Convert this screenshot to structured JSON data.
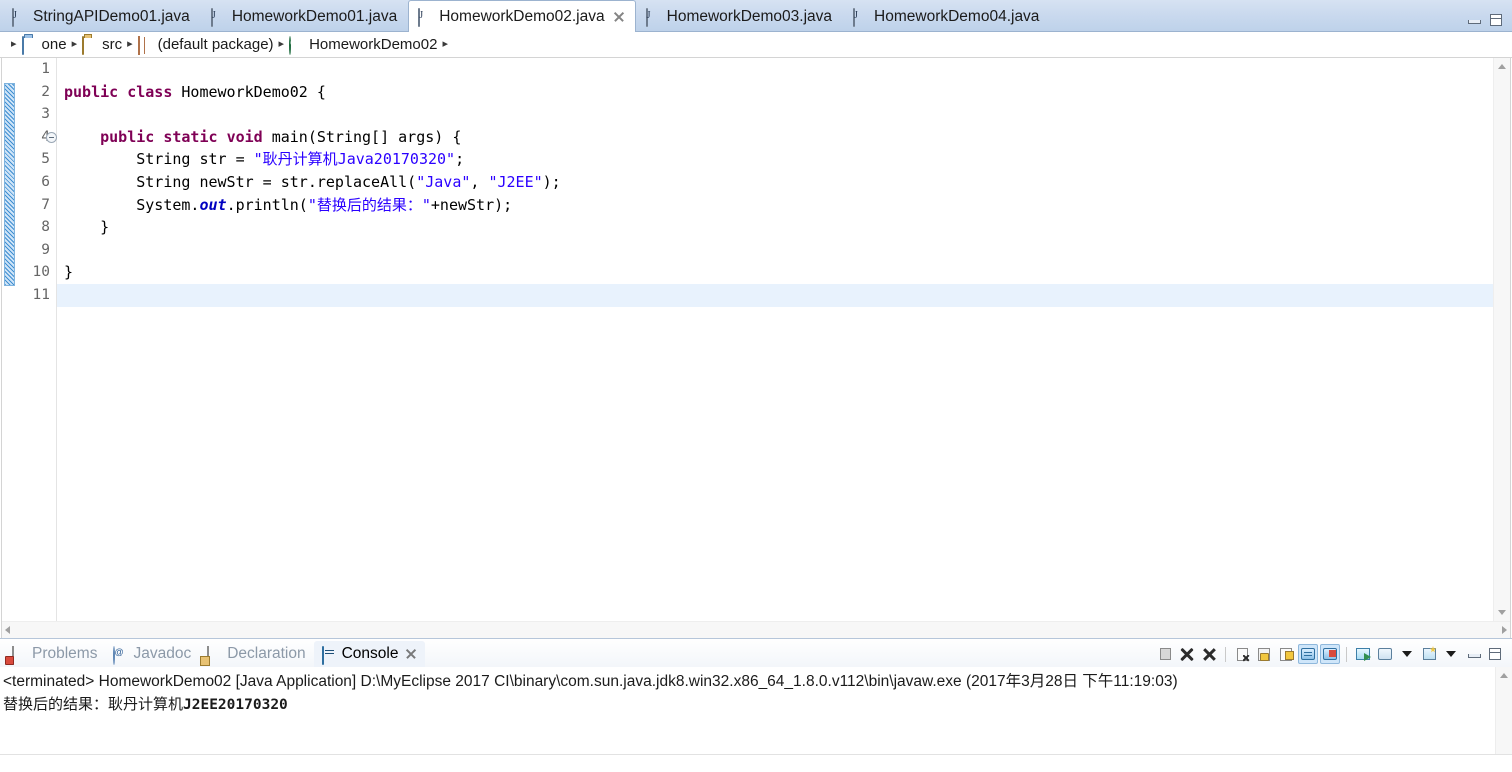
{
  "editor_tabs": [
    {
      "label": "StringAPIDemo01.java",
      "icon": "java-file-icon",
      "active": false,
      "closable": false
    },
    {
      "label": "HomeworkDemo01.java",
      "icon": "java-file-icon",
      "active": false,
      "closable": false
    },
    {
      "label": "HomeworkDemo02.java",
      "icon": "java-file-icon",
      "active": true,
      "closable": true
    },
    {
      "label": "HomeworkDemo03.java",
      "icon": "java-file-icon",
      "active": false,
      "closable": false
    },
    {
      "label": "HomeworkDemo04.java",
      "icon": "java-file-icon",
      "active": false,
      "closable": false
    }
  ],
  "window_controls": {
    "minimize": "minimize-icon",
    "maximize": "maximize-icon"
  },
  "breadcrumb": {
    "separator": "▸",
    "items": [
      {
        "label": "one",
        "icon": "project-icon"
      },
      {
        "label": "src",
        "icon": "source-folder-icon"
      },
      {
        "label": "(default package)",
        "icon": "package-icon"
      },
      {
        "label": "HomeworkDemo02",
        "icon": "class-icon"
      }
    ]
  },
  "editor": {
    "line_numbers": [
      "1",
      "2",
      "3",
      "4",
      "5",
      "6",
      "7",
      "8",
      "9",
      "10",
      "11"
    ],
    "fold_marker_line": 4,
    "current_line": 11,
    "marker_bar": {
      "from_line": 2,
      "to_line": 10
    },
    "colors": {
      "keyword": "#7f0055",
      "string": "#2a00ff",
      "static_field": "#0000c0",
      "plain": "#000000",
      "current_line_bg": "#e8f2fd",
      "line_number": "#666666"
    },
    "lines": [
      {
        "n": 1,
        "tokens": []
      },
      {
        "n": 2,
        "tokens": [
          {
            "t": "public",
            "c": "kw"
          },
          {
            "t": " ",
            "c": "plain"
          },
          {
            "t": "class",
            "c": "kw"
          },
          {
            "t": " HomeworkDemo02 {",
            "c": "plain"
          }
        ]
      },
      {
        "n": 3,
        "tokens": []
      },
      {
        "n": 4,
        "tokens": [
          {
            "t": "    ",
            "c": "plain"
          },
          {
            "t": "public",
            "c": "kw"
          },
          {
            "t": " ",
            "c": "plain"
          },
          {
            "t": "static",
            "c": "kw"
          },
          {
            "t": " ",
            "c": "plain"
          },
          {
            "t": "void",
            "c": "kw"
          },
          {
            "t": " main(String[] args) {",
            "c": "plain"
          }
        ]
      },
      {
        "n": 5,
        "tokens": [
          {
            "t": "        String str = ",
            "c": "plain"
          },
          {
            "t": "\"耿丹计算机Java20170320\"",
            "c": "str"
          },
          {
            "t": ";",
            "c": "plain"
          }
        ]
      },
      {
        "n": 6,
        "tokens": [
          {
            "t": "        String newStr = str.replaceAll(",
            "c": "plain"
          },
          {
            "t": "\"Java\"",
            "c": "str"
          },
          {
            "t": ", ",
            "c": "plain"
          },
          {
            "t": "\"J2EE\"",
            "c": "str"
          },
          {
            "t": ");",
            "c": "plain"
          }
        ]
      },
      {
        "n": 7,
        "tokens": [
          {
            "t": "        System.",
            "c": "plain"
          },
          {
            "t": "out",
            "c": "fld"
          },
          {
            "t": ".println(",
            "c": "plain"
          },
          {
            "t": "\"替换后的结果：\"",
            "c": "str"
          },
          {
            "t": "+newStr);",
            "c": "plain"
          }
        ]
      },
      {
        "n": 8,
        "tokens": [
          {
            "t": "    }",
            "c": "plain"
          }
        ]
      },
      {
        "n": 9,
        "tokens": []
      },
      {
        "n": 10,
        "tokens": [
          {
            "t": "}",
            "c": "plain"
          }
        ]
      },
      {
        "n": 11,
        "tokens": []
      }
    ],
    "scrollbar": {
      "vertical_up": "chevron-up-icon",
      "vertical_down": "chevron-down-icon",
      "horizontal_left": "chevron-left-icon",
      "horizontal_right": "chevron-right-icon"
    }
  },
  "bottom_panel": {
    "view_tabs": [
      {
        "label": "Problems",
        "icon": "problems-icon",
        "active": false,
        "closable": false
      },
      {
        "label": "Javadoc",
        "icon": "javadoc-icon",
        "active": false,
        "closable": false
      },
      {
        "label": "Declaration",
        "icon": "declaration-icon",
        "active": false,
        "closable": false
      },
      {
        "label": "Console",
        "icon": "console-icon",
        "active": true,
        "closable": true
      }
    ],
    "toolbar_buttons": [
      {
        "name": "terminate-button",
        "icon": "stop-square-icon",
        "pressed": false
      },
      {
        "name": "remove-launch-button",
        "icon": "remove-x-icon",
        "pressed": false
      },
      {
        "name": "remove-all-terminated-button",
        "icon": "remove-all-xx-icon",
        "pressed": false
      },
      {
        "name": "separator-1",
        "icon": "separator",
        "pressed": false
      },
      {
        "name": "clear-console-button",
        "icon": "clear-console-icon",
        "pressed": false
      },
      {
        "name": "scroll-lock-button",
        "icon": "scroll-lock-icon",
        "pressed": false
      },
      {
        "name": "word-wrap-button",
        "icon": "word-wrap-icon",
        "pressed": false
      },
      {
        "name": "show-console-on-output-button",
        "icon": "show-console-output-icon",
        "pressed": true
      },
      {
        "name": "show-console-on-error-button",
        "icon": "show-console-error-icon",
        "pressed": true
      },
      {
        "name": "separator-2",
        "icon": "separator",
        "pressed": false
      },
      {
        "name": "pin-console-button",
        "icon": "pin-console-icon",
        "pressed": false
      },
      {
        "name": "display-selected-console-button",
        "icon": "display-console-icon",
        "pressed": false
      },
      {
        "name": "display-selected-console-menu",
        "icon": "chevron-down-icon",
        "pressed": false
      },
      {
        "name": "open-console-button",
        "icon": "open-console-icon",
        "pressed": false
      },
      {
        "name": "open-console-menu",
        "icon": "chevron-down-icon",
        "pressed": false
      },
      {
        "name": "minimize-panel-button",
        "icon": "minimize-icon",
        "pressed": false
      },
      {
        "name": "maximize-panel-button",
        "icon": "maximize-icon",
        "pressed": false
      }
    ],
    "console": {
      "status_line": "<terminated> HomeworkDemo02 [Java Application] D:\\MyEclipse 2017 CI\\binary\\com.sun.java.jdk8.win32.x86_64_1.8.0.v112\\bin\\javaw.exe (2017年3月28日 下午11:19:03)",
      "output_prefix": "替换后的结果：耿丹计算机",
      "output_mono": "J2EE20170320"
    }
  }
}
